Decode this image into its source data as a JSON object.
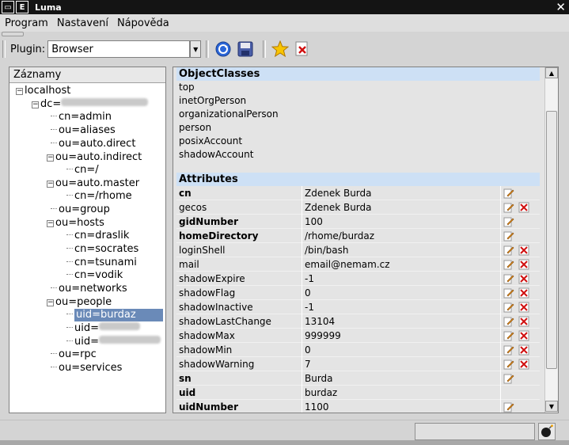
{
  "window": {
    "title": "Luma",
    "btn1": "▭",
    "btn2": "E",
    "close": "✕"
  },
  "menu": [
    "Program",
    "Nastavení",
    "Nápověda"
  ],
  "toolbar": {
    "plugin_label": "Plugin:",
    "plugin_value": "Browser"
  },
  "tree": {
    "header": "Záznamy",
    "root": "localhost",
    "dc_prefix": "dc=",
    "items": [
      {
        "label": "cn=admin"
      },
      {
        "label": "ou=aliases"
      },
      {
        "label": "ou=auto.direct"
      },
      {
        "label": "ou=auto.indirect"
      },
      {
        "label": "cn=/"
      },
      {
        "label": "ou=auto.master"
      },
      {
        "label": "cn=/rhome"
      },
      {
        "label": "ou=group"
      },
      {
        "label": "ou=hosts"
      },
      {
        "label": "cn=draslik"
      },
      {
        "label": "cn=socrates"
      },
      {
        "label": "cn=tsunami"
      },
      {
        "label": "cn=vodik"
      },
      {
        "label": "ou=networks"
      },
      {
        "label": "ou=people"
      },
      {
        "label": "uid=burdaz"
      },
      {
        "label": "uid="
      },
      {
        "label": "uid="
      },
      {
        "label": "ou=rpc"
      },
      {
        "label": "ou=services"
      }
    ]
  },
  "objectclasses": {
    "header": "ObjectClasses",
    "items": [
      "top",
      "inetOrgPerson",
      "organizationalPerson",
      "person",
      "posixAccount",
      "shadowAccount"
    ]
  },
  "attributes": {
    "header": "Attributes",
    "rows": [
      {
        "name": "cn",
        "value": "Zdenek Burda"
      },
      {
        "name": "gecos",
        "value": "Zdenek Burda"
      },
      {
        "name": "gidNumber",
        "value": "100"
      },
      {
        "name": "homeDirectory",
        "value": "/rhome/burdaz"
      },
      {
        "name": "loginShell",
        "value": "/bin/bash"
      },
      {
        "name": "mail",
        "value": "email@nemam.cz"
      },
      {
        "name": "shadowExpire",
        "value": "-1"
      },
      {
        "name": "shadowFlag",
        "value": "0"
      },
      {
        "name": "shadowInactive",
        "value": "-1"
      },
      {
        "name": "shadowLastChange",
        "value": "13104"
      },
      {
        "name": "shadowMax",
        "value": "999999"
      },
      {
        "name": "shadowMin",
        "value": "0"
      },
      {
        "name": "shadowWarning",
        "value": "7"
      },
      {
        "name": "sn",
        "value": "Burda"
      },
      {
        "name": "uid",
        "value": "burdaz"
      },
      {
        "name": "uidNumber",
        "value": "1100"
      }
    ]
  },
  "colors": {
    "selection": "#6a8ab8",
    "section_header": "#cde0f5",
    "titlebar": "#141414"
  }
}
